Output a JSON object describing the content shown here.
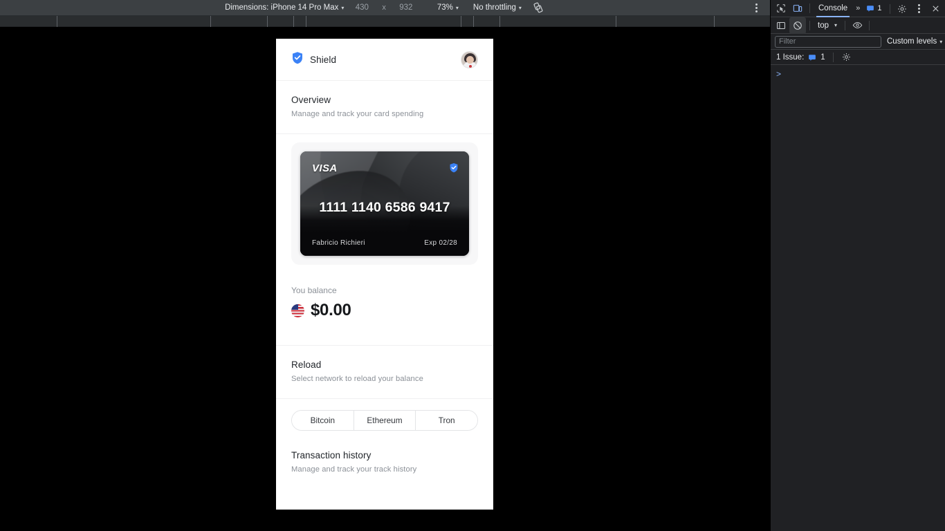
{
  "device_toolbar": {
    "dimensions_label": "Dimensions: iPhone 14 Pro Max",
    "width": "430",
    "x_symbol": "x",
    "height": "932",
    "zoom": "73%",
    "throttling": "No throttling",
    "rotate_icon": "rotate-device-icon",
    "more_options_icon": "kebab-menu-icon"
  },
  "app": {
    "brand": {
      "name": "Shield",
      "logo_icon": "shield-check-icon",
      "logo_color": "#3b82f6"
    },
    "avatar_name": "user-avatar",
    "overview": {
      "title": "Overview",
      "subtitle": "Manage and track your card spending"
    },
    "card": {
      "brand_logo": "VISA",
      "shield_icon": "shield-check-icon",
      "number": "1111 1140 6586 9417",
      "holder": "Fabricio Richieri",
      "expiry": "Exp 02/28"
    },
    "balance": {
      "label": "You balance",
      "flag_icon": "us-flag-icon",
      "amount": "$0.00"
    },
    "reload": {
      "title": "Reload",
      "subtitle": "Select network to reload your balance",
      "networks": [
        {
          "label": "Bitcoin"
        },
        {
          "label": "Ethereum"
        },
        {
          "label": "Tron"
        }
      ]
    },
    "history": {
      "title": "Transaction history",
      "subtitle": "Manage and track your track history"
    }
  },
  "devtools": {
    "inspect_icon": "inspect-element-icon",
    "device_toggle_icon": "toggle-device-toolbar-icon",
    "tabs": [
      {
        "label": "Console",
        "selected": true
      }
    ],
    "more_tabs_icon": "more-tabs-chevron-icon",
    "issues_badge_icon": "issue-message-icon",
    "issues_badge_count": "1",
    "settings_icon": "gear-icon",
    "main_menu_icon": "kebab-menu-icon",
    "close_icon": "close-icon",
    "sidebar_toggle_icon": "console-sidebar-icon",
    "clear_console_icon": "clear-console-icon",
    "context": "top",
    "eye_icon": "live-expression-icon",
    "filter_placeholder": "Filter",
    "filter_value": "",
    "levels_label": "Custom levels",
    "issues_bar": {
      "text": "1 Issue:",
      "icon": "issue-message-icon",
      "count": "1",
      "settings_icon": "gear-icon"
    },
    "prompt_caret": ">",
    "accent_color": "#8ab4f8"
  }
}
